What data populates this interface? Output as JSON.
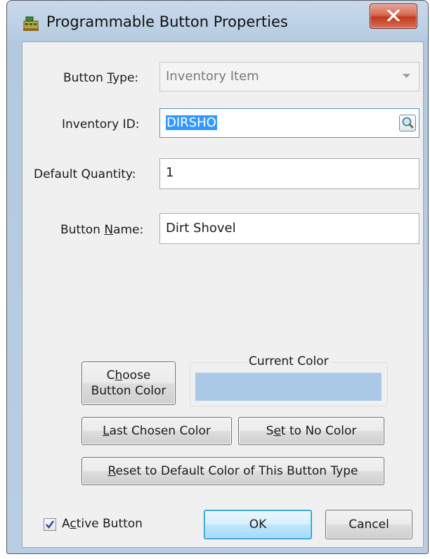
{
  "window": {
    "title": "Programmable Button Properties"
  },
  "form": {
    "button_type": {
      "label_pre": "Button ",
      "label_u": "T",
      "label_post": "ype:",
      "value": "Inventory Item"
    },
    "inventory_id": {
      "label": "Inventory ID:",
      "value": "DIRSHO"
    },
    "default_quantity": {
      "label": "Default Quantity:",
      "value": "1"
    },
    "button_name": {
      "label_pre": "Button ",
      "label_u": "N",
      "label_post": "ame:",
      "value": "Dirt Shovel"
    }
  },
  "color": {
    "choose_line1_pre": "C",
    "choose_line1_u": "h",
    "choose_line1_post": "oose",
    "choose_line2": "Button Color",
    "current_color_label": "Current Color",
    "current_color_value": "#a9c9e6",
    "last_chosen_u": "L",
    "last_chosen_post": "ast Chosen Color",
    "set_no_pre": "S",
    "set_no_u": "e",
    "set_no_post": "t to No Color",
    "reset_u": "R",
    "reset_post": "eset to Default Color of This Button Type"
  },
  "footer": {
    "active_pre": "A",
    "active_u": "c",
    "active_post": "tive Button",
    "active_checked": true,
    "ok_label": "OK",
    "cancel_label": "Cancel"
  }
}
